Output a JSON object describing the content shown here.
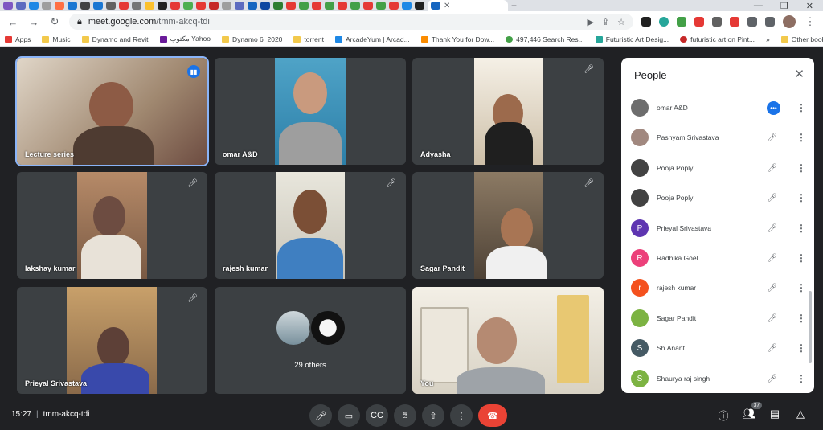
{
  "browser": {
    "url_domain": "meet.google.com",
    "url_path": "/tmm-akcq-tdi",
    "bookmarks": [
      "Apps",
      "Music",
      "Dynamo and Revit",
      "مكتوب Yahoo",
      "Dynamo 6_2020",
      "torrent",
      "ArcadeYum | Arcad...",
      "Thank You for Dow...",
      "497,446 Search Res...",
      "Futuristic Art Desig...",
      "futuristic art on Pint..."
    ],
    "more_bookmarks": "»",
    "other_bookmarks": "Other bookmarks"
  },
  "tiles": [
    {
      "name": "Lecture series"
    },
    {
      "name": "omar A&D"
    },
    {
      "name": "Adyasha"
    },
    {
      "name": "lakshay kumar"
    },
    {
      "name": "rajesh kumar"
    },
    {
      "name": "Sagar Pandit"
    },
    {
      "name": "Prieyal Srivastava"
    },
    {
      "name": "29 others"
    },
    {
      "name": "You"
    }
  ],
  "people_panel": {
    "title": "People",
    "people": [
      {
        "name": "omar A&D",
        "initial": "",
        "color": "#6d6d6d"
      },
      {
        "name": "Pashyam Srivastava",
        "initial": "",
        "color": "#a1887f"
      },
      {
        "name": "Pooja Poply",
        "initial": "",
        "color": "#424242"
      },
      {
        "name": "Pooja Poply",
        "initial": "",
        "color": "#424242"
      },
      {
        "name": "Prieyal Srivastava",
        "initial": "P",
        "color": "#5e35b1"
      },
      {
        "name": "Radhika Goel",
        "initial": "R",
        "color": "#ec407a"
      },
      {
        "name": "rajesh kumar",
        "initial": "r",
        "color": "#f4511e"
      },
      {
        "name": "Sagar Pandit",
        "initial": "",
        "color": "#7cb342"
      },
      {
        "name": "Sh.Anant",
        "initial": "S",
        "color": "#455a64"
      },
      {
        "name": "Shaurya raj singh",
        "initial": "S",
        "color": "#7cb342"
      }
    ]
  },
  "bottom_bar": {
    "time": "15:27",
    "meeting_code": "tmm-akcq-tdi",
    "participant_count": "37"
  }
}
